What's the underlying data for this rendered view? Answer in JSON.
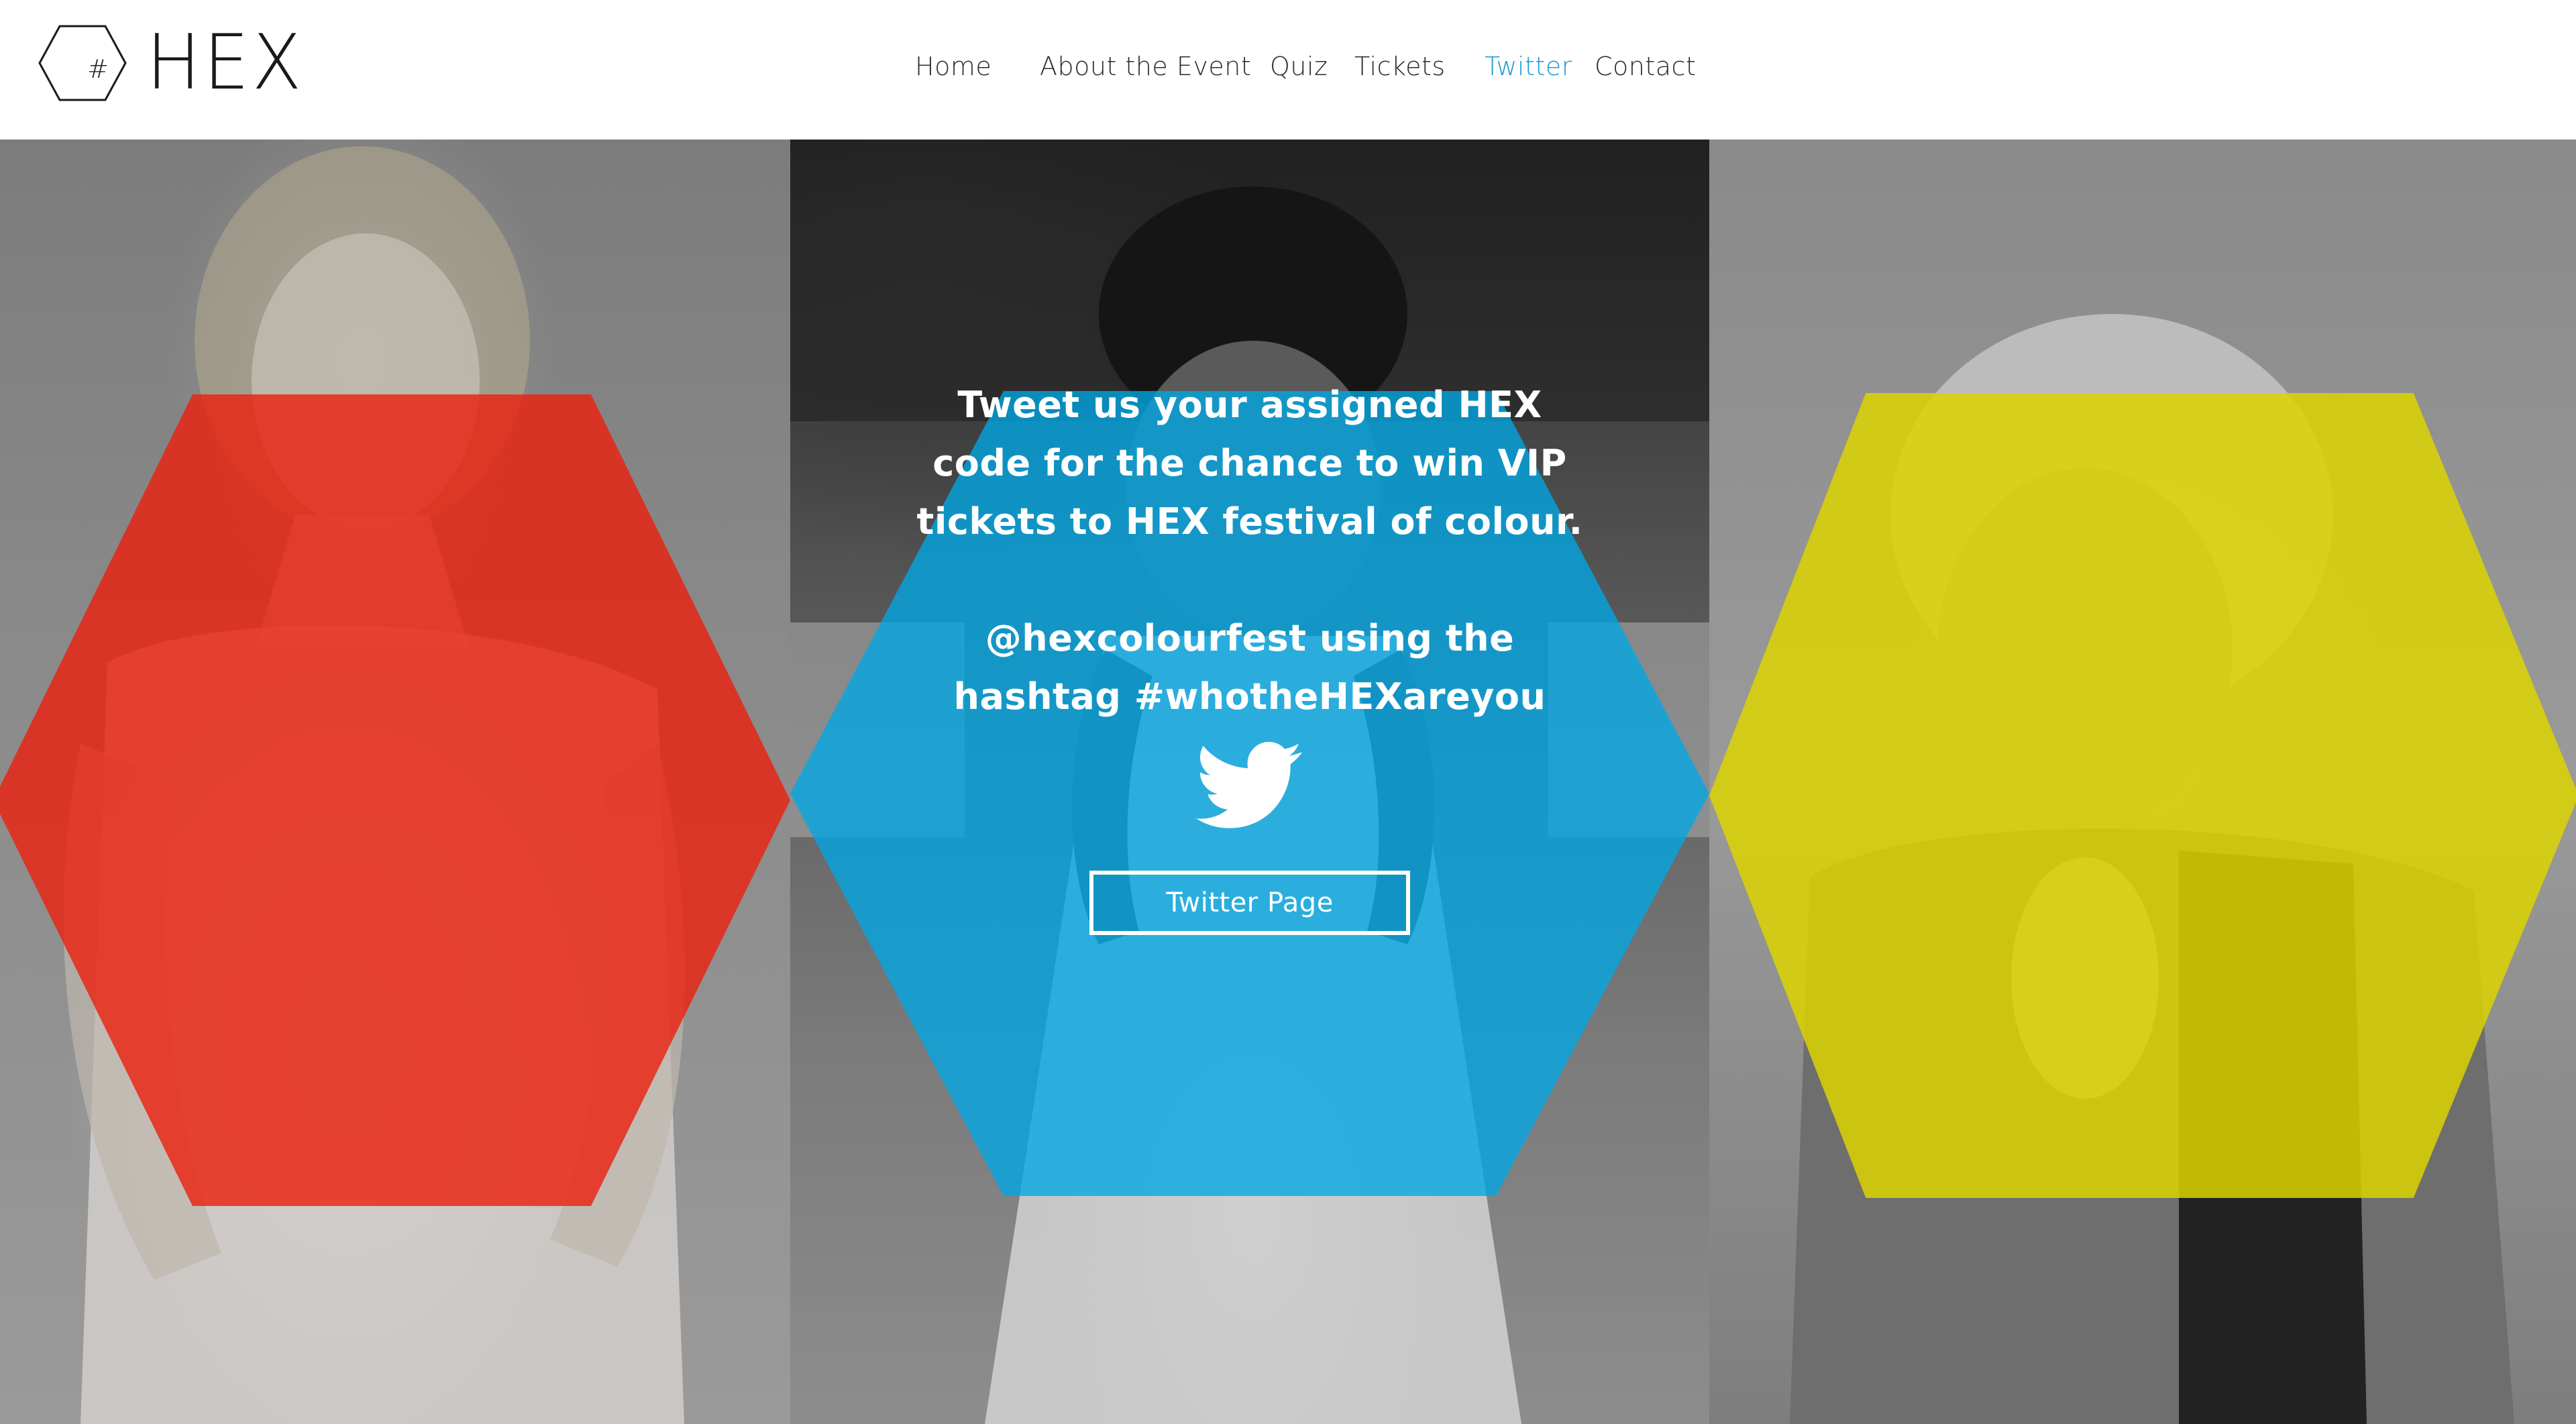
{
  "brand": {
    "logo_hash": "#",
    "name": "HEX"
  },
  "nav": {
    "items": [
      {
        "label": "Home",
        "active": false
      },
      {
        "label": "About the Event",
        "active": false
      },
      {
        "label": "Quiz",
        "active": false
      },
      {
        "label": "Tickets",
        "active": false
      },
      {
        "label": "Twitter",
        "active": true
      },
      {
        "label": "Contact",
        "active": false
      }
    ]
  },
  "hero": {
    "hex_colors": {
      "left": "#EA2210",
      "center": "#00A8E6",
      "right": "#DCD400"
    },
    "tweet_line_1": "Tweet us your assigned HEX code for the chance to win VIP tickets to HEX festival of colour.",
    "tweet_line_2": "@hexcolourfest using the hashtag #whotheHEXareyou",
    "bird_icon": "twitter-bird-icon",
    "button_label": "Twitter Page"
  },
  "colors": {
    "accent": "#1A9AD6",
    "text": "#2B2B2B",
    "white": "#FFFFFF"
  }
}
